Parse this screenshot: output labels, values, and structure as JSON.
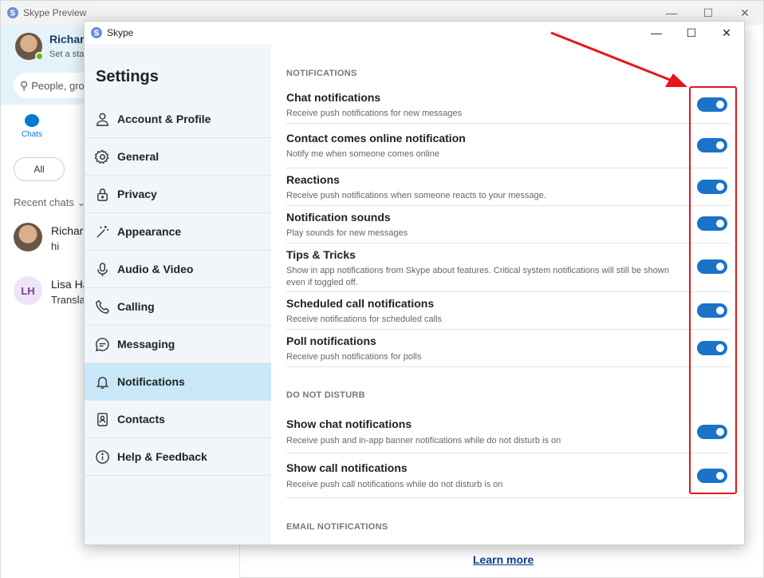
{
  "background_window": {
    "title": "Skype Preview",
    "controls": {
      "minimize": "—",
      "maximize": "☐",
      "close": "✕"
    },
    "profile": {
      "name": "Richard",
      "status": "Set a status"
    },
    "search": {
      "placeholder": "People, groups"
    },
    "chats_tab": "Chats",
    "filter_all": "All",
    "recent_chats": "Recent chats ⌄",
    "chats": [
      {
        "name": "Richard",
        "message": "hi"
      },
      {
        "initials": "LH",
        "name": "Lisa Ha",
        "message": "Translat"
      }
    ],
    "learn_more": "Learn more"
  },
  "dialog": {
    "title": "Skype",
    "controls": {
      "minimize": "—",
      "maximize": "☐",
      "close": "✕"
    },
    "heading": "Settings",
    "nav": [
      {
        "label": "Account & Profile",
        "icon": "person-icon"
      },
      {
        "label": "General",
        "icon": "gear-icon"
      },
      {
        "label": "Privacy",
        "icon": "lock-icon"
      },
      {
        "label": "Appearance",
        "icon": "magic-wand-icon"
      },
      {
        "label": "Audio & Video",
        "icon": "microphone-icon"
      },
      {
        "label": "Calling",
        "icon": "phone-icon"
      },
      {
        "label": "Messaging",
        "icon": "chat-bubble-icon"
      },
      {
        "label": "Notifications",
        "icon": "bell-icon",
        "active": true
      },
      {
        "label": "Contacts",
        "icon": "contact-book-icon"
      },
      {
        "label": "Help & Feedback",
        "icon": "info-icon"
      }
    ],
    "sections": {
      "notifications": "NOTIFICATIONS",
      "do_not_disturb": "DO NOT DISTURB",
      "email_notifications": "EMAIL NOTIFICATIONS"
    },
    "notification_settings": [
      {
        "title": "Chat notifications",
        "description": "Receive push notifications for new messages",
        "on": true
      },
      {
        "title": "Contact comes online notification",
        "description": "Notify me when someone comes online",
        "on": true
      },
      {
        "title": "Reactions",
        "description": "Receive push notifications when someone reacts to your message.",
        "on": true
      },
      {
        "title": "Notification sounds",
        "description": "Play sounds for new messages",
        "on": true
      },
      {
        "title": "Tips & Tricks",
        "description": "Show in app notifications from Skype about features. Critical system notifications will still be shown even if toggled off.",
        "on": true
      },
      {
        "title": "Scheduled call notifications",
        "description": "Receive notifications for scheduled calls",
        "on": true
      },
      {
        "title": "Poll notifications",
        "description": "Receive push notifications for polls",
        "on": true
      }
    ],
    "dnd_settings": [
      {
        "title": "Show chat notifications",
        "description": "Receive push and in-app banner notifications while do not disturb is on",
        "on": true
      },
      {
        "title": "Show call notifications",
        "description": "Receive push call notifications while do not disturb is on",
        "on": true
      }
    ]
  },
  "colors": {
    "toggle_on": "#1a73c9",
    "active_nav": "#c8e8f7",
    "annotation": "#e8141c"
  }
}
